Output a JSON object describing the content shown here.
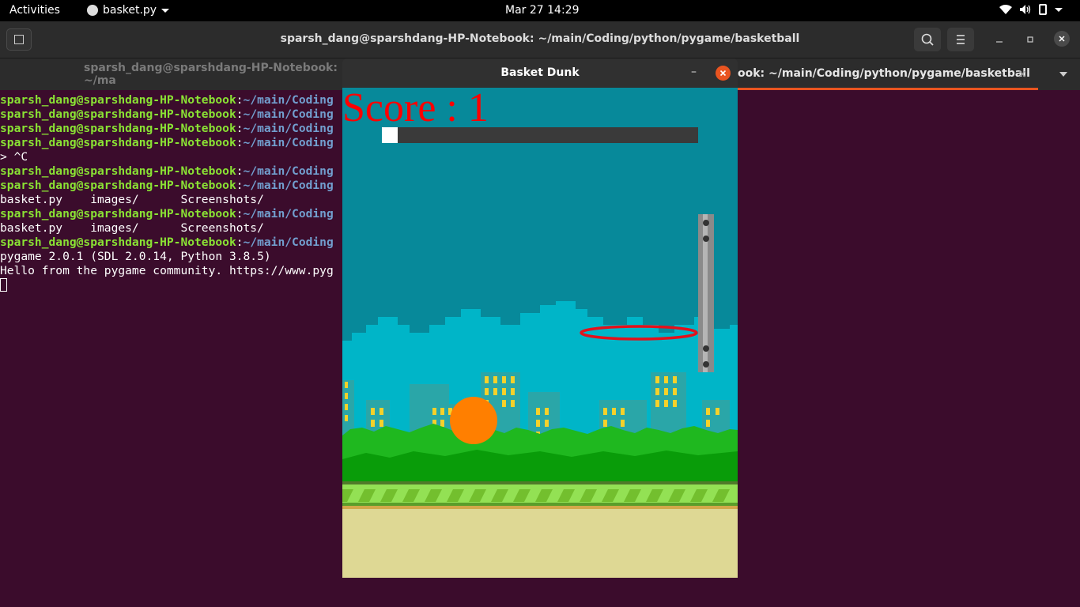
{
  "topbar": {
    "activities": "Activities",
    "app_name": "basket.py",
    "clock": "Mar 27  14:29",
    "icons": [
      "wifi-icon",
      "volume-icon",
      "battery-icon",
      "system-menu-caret-icon"
    ]
  },
  "terminal_window": {
    "title": "sparsh_dang@sparshdang-HP-Notebook: ~/main/Coding/python/pygame/basketball",
    "tabs": [
      {
        "label": "sparsh_dang@sparshdang-HP-Notebook: ~/ma",
        "active": false
      },
      {
        "label": "ook: ~/main/Coding/python/pygame/basketball",
        "active": true
      }
    ],
    "tab_close": "×",
    "lines": [
      {
        "user": "sparsh_dang@sparshdang-HP-Notebook",
        "sep": ":",
        "path": "~/main/Coding"
      },
      {
        "user": "sparsh_dang@sparshdang-HP-Notebook",
        "sep": ":",
        "path": "~/main/Coding"
      },
      {
        "user": "sparsh_dang@sparshdang-HP-Notebook",
        "sep": ":",
        "path": "~/main/Coding"
      },
      {
        "user": "sparsh_dang@sparshdang-HP-Notebook",
        "sep": ":",
        "path": "~/main/Coding"
      },
      {
        "text": "> ^C"
      },
      {
        "user": "sparsh_dang@sparshdang-HP-Notebook",
        "sep": ":",
        "path": "~/main/Coding"
      },
      {
        "user": "sparsh_dang@sparshdang-HP-Notebook",
        "sep": ":",
        "path": "~/main/Coding"
      },
      {
        "text": "basket.py    images/      Screenshots/"
      },
      {
        "user": "sparsh_dang@sparshdang-HP-Notebook",
        "sep": ":",
        "path": "~/main/Coding"
      },
      {
        "text": "basket.py    images/      Screenshots/"
      },
      {
        "user": "sparsh_dang@sparshdang-HP-Notebook",
        "sep": ":",
        "path": "~/main/Coding"
      },
      {
        "text": "pygame 2.0.1 (SDL 2.0.14, Python 3.8.5)"
      },
      {
        "text": "Hello from the pygame community. https://www.pyg"
      }
    ]
  },
  "game_window": {
    "title": "Basket Dunk",
    "minimize_symbol": "–",
    "close_symbol": "×",
    "score_text": "Score : 1",
    "power_fraction": 0.0,
    "colors": {
      "sky": "#07899a",
      "clouds": "#00b5c8",
      "buildings": "#2aa6a8",
      "windows": "#f6d12a",
      "bushes": "#1fb81f",
      "ground_stripe": "#93e154",
      "ground": "#ded894",
      "ball": "#ff7f00",
      "hoop": "#e3111b",
      "score": "#ff0000"
    }
  },
  "theme": {
    "terminal_bg": "#3b0c2c",
    "user_host_color": "#8ae234",
    "path_color": "#729fcf",
    "accent": "#e95420"
  }
}
